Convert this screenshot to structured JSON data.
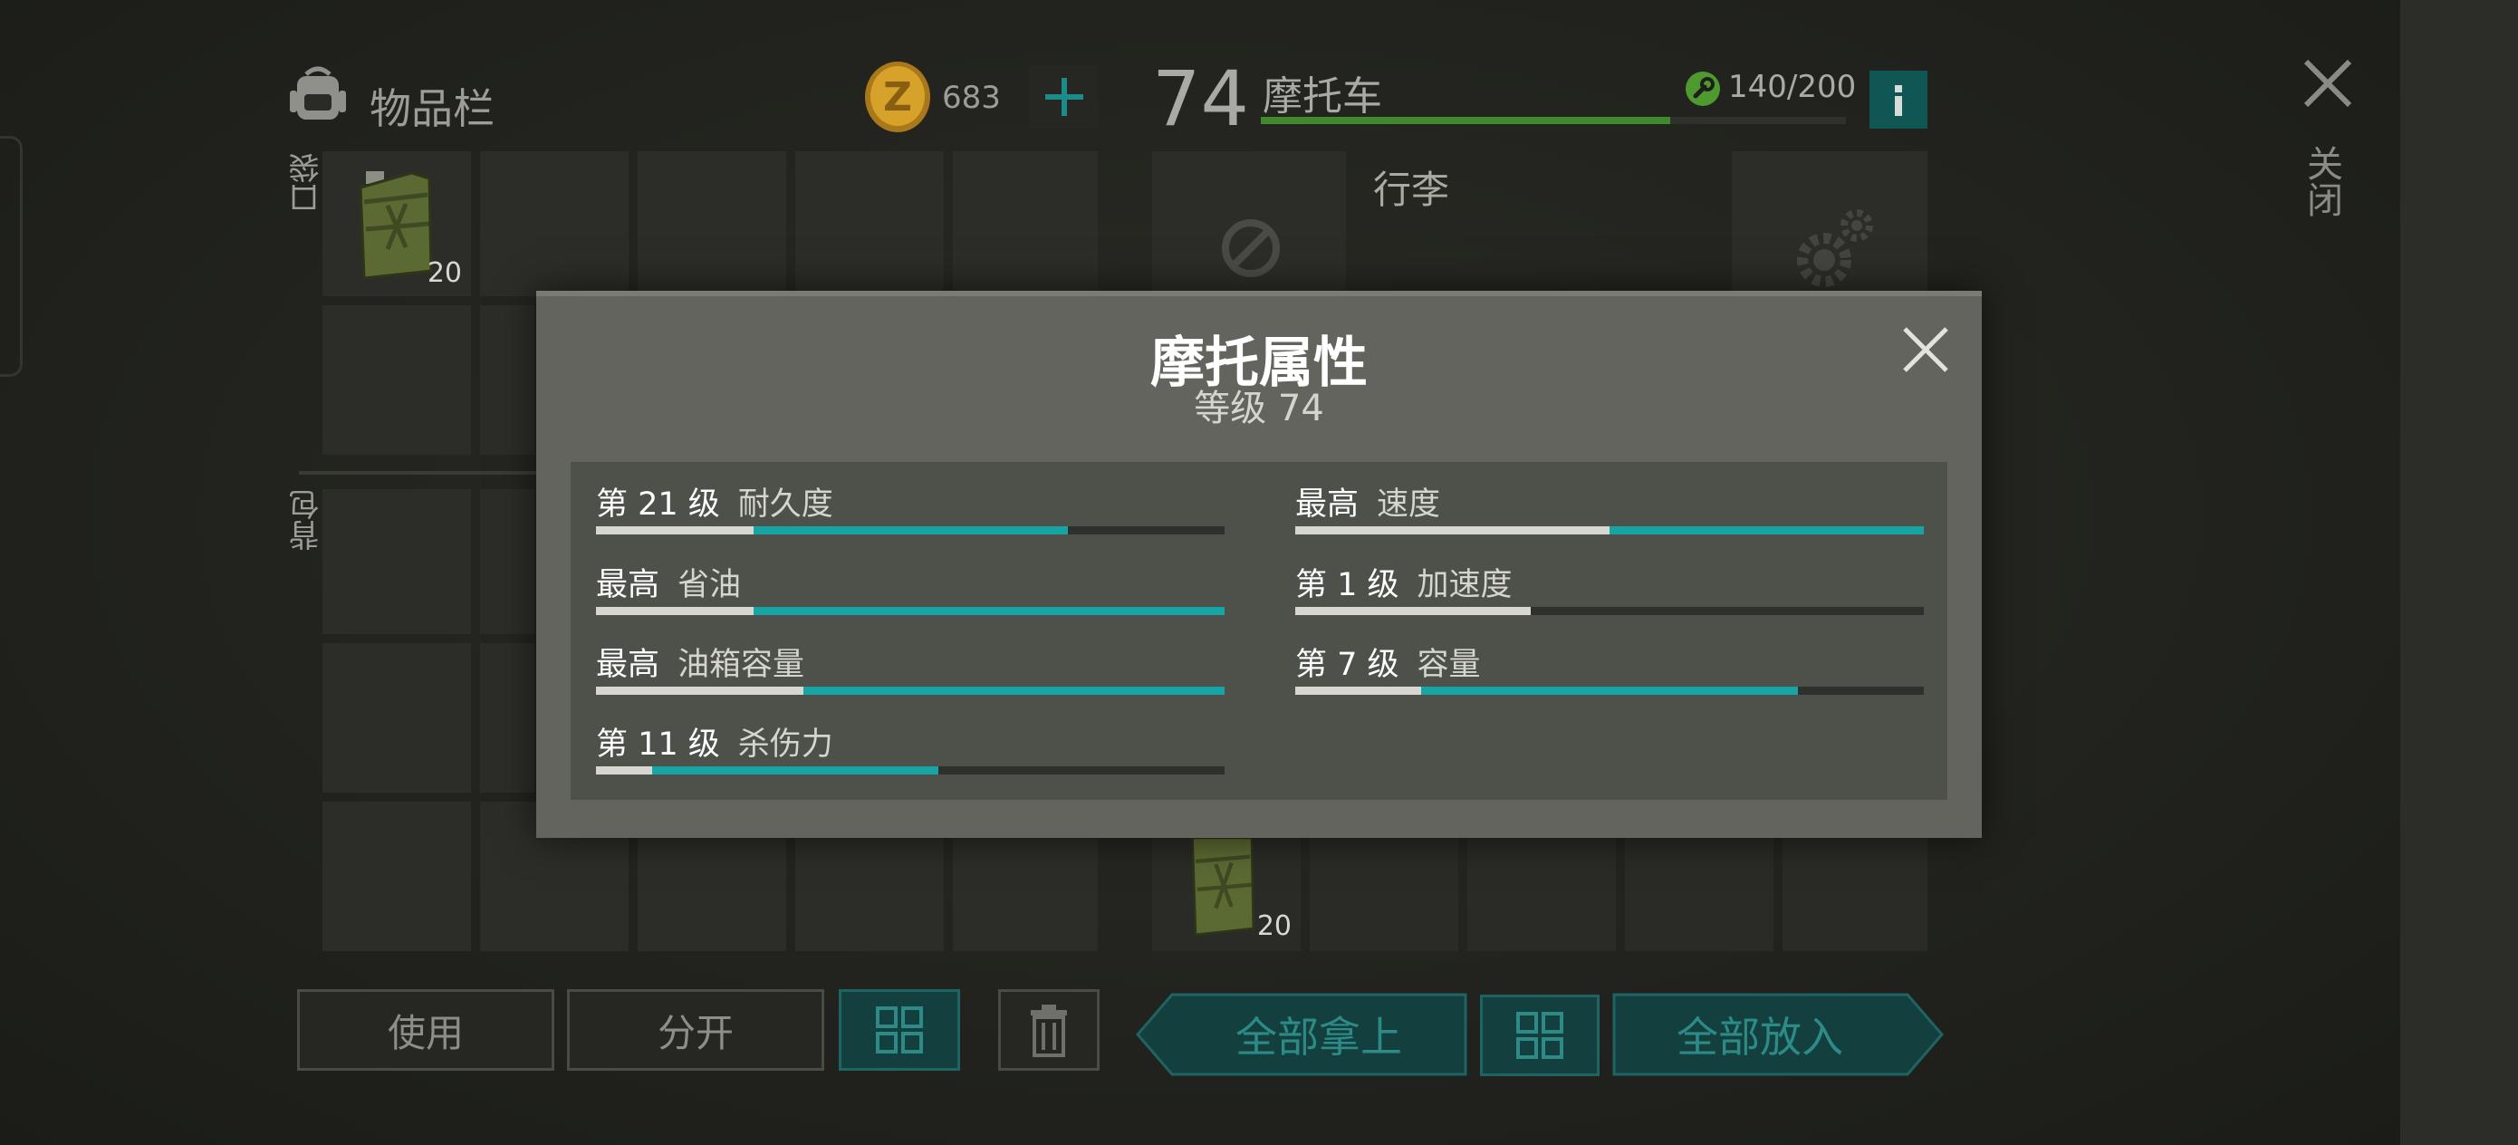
{
  "inventory": {
    "title": "物品栏",
    "coins": "683",
    "pocket_label": "口袋",
    "backpack_label": "背包",
    "item_qty": "20"
  },
  "vehicle": {
    "level": "74",
    "name": "摩托车",
    "durability_text": "140/200",
    "durability_fraction": 0.7,
    "trunk_label": "行李",
    "item_qty": "20"
  },
  "window": {
    "close_label": "关闭"
  },
  "buttons": {
    "use": "使用",
    "split": "分开",
    "take_all": "全部拿上",
    "put_all": "全部放入"
  },
  "modal": {
    "title": "摩托属性",
    "subtitle": "等级 74",
    "stats": [
      {
        "level": "第 21 级",
        "name": "耐久度",
        "base": 0.25,
        "upgraded": 0.75
      },
      {
        "level": "最高",
        "name": "速度",
        "base": 0.5,
        "upgraded": 1.0
      },
      {
        "level": "最高",
        "name": "省油",
        "base": 0.25,
        "upgraded": 1.0
      },
      {
        "level": "第 1 级",
        "name": "加速度",
        "base": 0.375,
        "upgraded": 0.375
      },
      {
        "level": "最高",
        "name": "油箱容量",
        "base": 0.33,
        "upgraded": 1.0
      },
      {
        "level": "第 7 级",
        "name": "容量",
        "base": 0.2,
        "upgraded": 0.8
      },
      {
        "level": "第 11 级",
        "name": "杀伤力",
        "base": 0.09,
        "upgraded": 0.545
      }
    ]
  },
  "colors": {
    "accent_teal": "#16a4a4",
    "durability_green": "#3f8a2c",
    "coin_gold": "#c9961e"
  },
  "icons": [
    "backpack-icon",
    "coin-icon",
    "plus-icon",
    "wrench-icon",
    "info-icon",
    "close-icon",
    "no-entry-icon",
    "gear-icon",
    "grid-icon",
    "trash-icon",
    "jerrycan-icon"
  ]
}
